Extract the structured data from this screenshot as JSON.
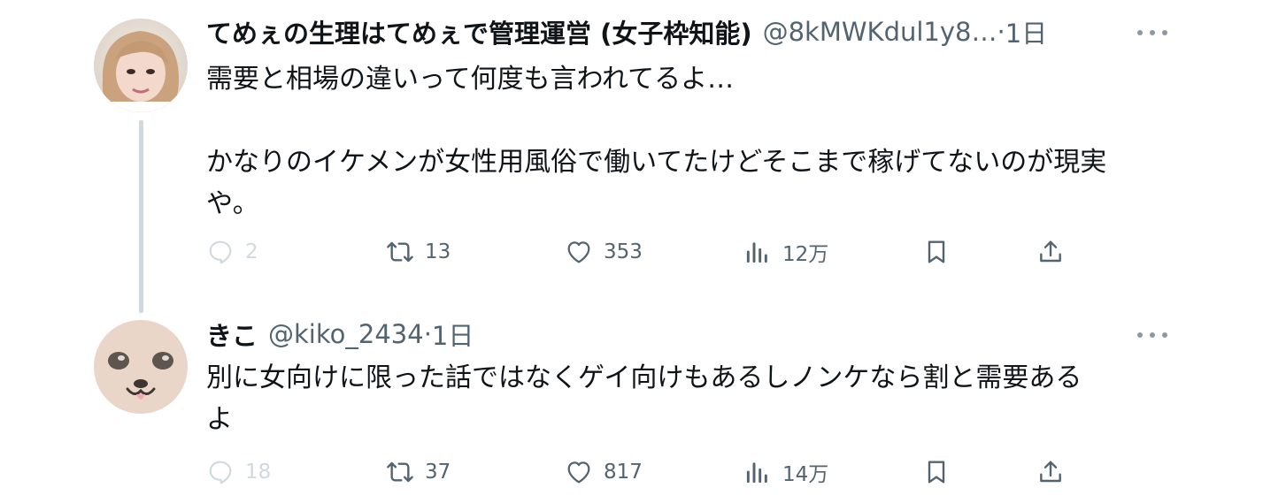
{
  "tweets": [
    {
      "display_name": "てめぇの生理はてめぇで管理運営 (女子枠知能)",
      "handle": "@8kMWKdul1y8…",
      "separator": "·",
      "time": "1日",
      "text_lines": [
        "需要と相場の違いって何度も言われてるよ…",
        "",
        "かなりのイケメンが女性用風俗で働いてたけどそこまで稼げてないのが現実",
        "や。"
      ],
      "replies": "2",
      "retweets": "13",
      "likes": "353",
      "views": "12万",
      "avatar": "user-photo-avatar"
    },
    {
      "display_name": "きこ",
      "handle": "@kiko_2434",
      "separator": "·",
      "time": "1日",
      "text_lines": [
        "別に女向けに限った話ではなくゲイ向けもあるしノンケなら割と需要ある",
        "よ"
      ],
      "replies": "18",
      "retweets": "37",
      "likes": "817",
      "views": "14万",
      "avatar": "seal-illustration-avatar"
    }
  ],
  "colors": {
    "text": "#0f1419",
    "secondary": "#536471",
    "faint": "#cfd9de",
    "thread_line": "#cfd9de"
  },
  "icons": [
    "reply-icon",
    "retweet-icon",
    "like-icon",
    "views-icon",
    "bookmark-icon",
    "share-icon",
    "more-icon"
  ]
}
